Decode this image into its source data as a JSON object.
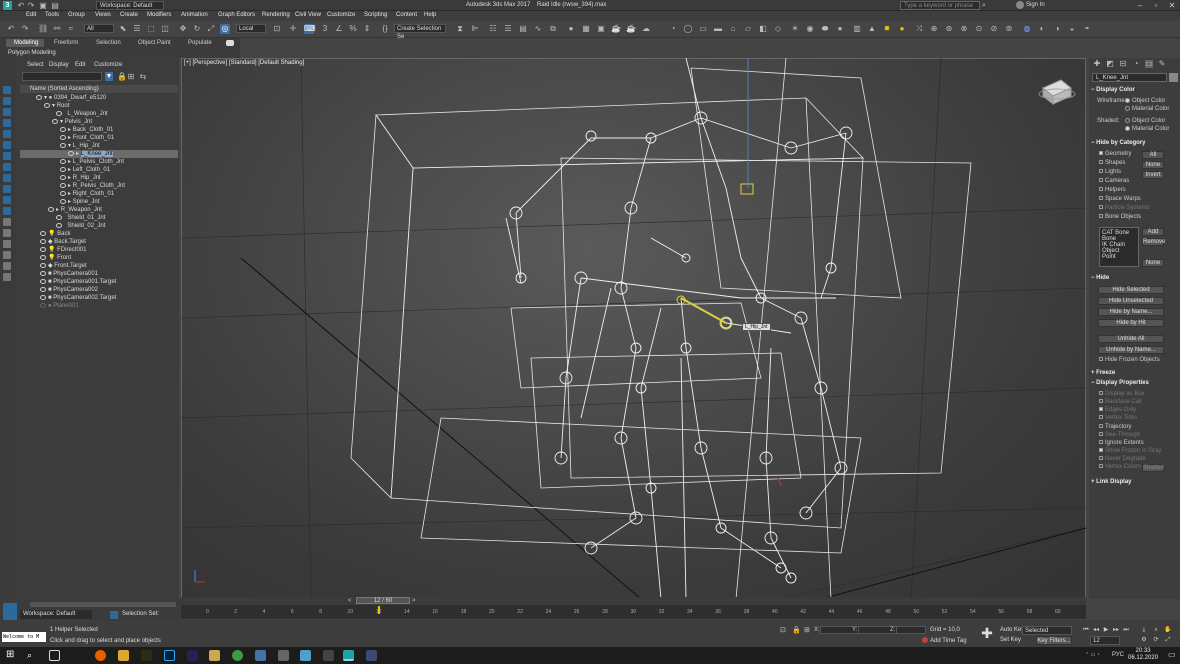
{
  "window": {
    "app_logo": "3",
    "workspace_label": "Workspace: Default",
    "title": "Autodesk 3ds Max 2017",
    "file_name": "Raid Idle (rwsw_394).max",
    "search_placeholder": "Type a keyword or phrase",
    "sign_in": "Sign In"
  },
  "menu": [
    "Edit",
    "Tools",
    "Group",
    "Views",
    "Create",
    "Modifiers",
    "Animation",
    "Graph Editors",
    "Rendering",
    "Civil View",
    "Customize",
    "Scripting",
    "Content",
    "Help"
  ],
  "toolbar": {
    "filter_dropdown": "All",
    "coord_dropdown": "Local",
    "create_selection_set": "Create Selection Se"
  },
  "ribbon": {
    "tabs": [
      "Modeling",
      "Freeform",
      "Selection",
      "Object Paint",
      "Populate"
    ],
    "sub_label": "Polygon Modeling"
  },
  "scene_explorer": {
    "menu": [
      "Select",
      "Display",
      "Edit",
      "Customize"
    ],
    "column_header": "Name (Sorted Ascending)",
    "rows": [
      {
        "label": "0394_Dwarf_e5120",
        "selected": false
      },
      {
        "label": "Root",
        "selected": false
      },
      {
        "label": "L_Weapon_Jnt",
        "selected": false
      },
      {
        "label": "Pelvis_Jnt",
        "selected": false
      },
      {
        "label": "Back_Cloth_01",
        "selected": false
      },
      {
        "label": "Front_Cloth_01",
        "selected": false
      },
      {
        "label": "L_Hip_Jnt",
        "selected": false
      },
      {
        "label": "L_Knee_Jnt",
        "selected": true
      },
      {
        "label": "L_Pelvis_Cloth_Jnt",
        "selected": false
      },
      {
        "label": "Left_Cloth_01",
        "selected": false
      },
      {
        "label": "R_Hip_Jnt",
        "selected": false
      },
      {
        "label": "R_Pelvis_Cloth_Jnt",
        "selected": false
      },
      {
        "label": "Right_Cloth_01",
        "selected": false
      },
      {
        "label": "Spine_Jnt",
        "selected": false
      },
      {
        "label": "R_Weapon_Jnt",
        "selected": false
      },
      {
        "label": "Shield_01_Jnt",
        "selected": false
      },
      {
        "label": "Shield_02_Jnt",
        "selected": false
      },
      {
        "label": "Back",
        "selected": false
      },
      {
        "label": "Back.Target",
        "selected": false
      },
      {
        "label": "FDirect001",
        "selected": false
      },
      {
        "label": "Front",
        "selected": false
      },
      {
        "label": "Front.Target",
        "selected": false
      },
      {
        "label": "PhysCamera001",
        "selected": false
      },
      {
        "label": "PhysCamera001.Target",
        "selected": false
      },
      {
        "label": "PhysCamera002",
        "selected": false
      },
      {
        "label": "PhysCamera002.Target",
        "selected": false
      },
      {
        "label": "Plane001",
        "selected": false
      }
    ]
  },
  "viewport": {
    "label": "[+] [Perspective] [Standard] [Default Shading]",
    "tooltip": "L_Hip_Jnt"
  },
  "command_panel": {
    "object_name": "L_Knee_Jnt",
    "display_color": {
      "title": "Display Color",
      "wireframe_label": "Wireframe:",
      "shaded_label": "Shaded:",
      "object_color": "Object Color",
      "material_color": "Material Color"
    },
    "hide_by_category": {
      "title": "Hide by Category",
      "items": [
        "Geometry",
        "Shapes",
        "Lights",
        "Cameras",
        "Helpers",
        "Space Warps",
        "Particle Systems",
        "Bone Objects"
      ],
      "buttons": [
        "All",
        "None",
        "Invert"
      ],
      "list": [
        "CAT Bone",
        "Bone",
        "IK Chain Object",
        "Point"
      ],
      "add": "Add",
      "remove": "Remove",
      "none": "None"
    },
    "hide": {
      "title": "Hide",
      "buttons": [
        "Hide Selected",
        "Hide Unselected",
        "Hide by Name...",
        "Hide by Hit",
        "Unhide All",
        "Unhide by Name...",
        "Hide Frozen Objects"
      ]
    },
    "freeze_title": "Freeze",
    "display_properties": {
      "title": "Display Properties",
      "items": [
        "Display as Box",
        "Backface Cull",
        "Edges Only",
        "Vertex Ticks",
        "Trajectory",
        "See-Through",
        "Ignore Extents",
        "Show Frozen in Gray",
        "Never Degrade",
        "Vertex Colors"
      ],
      "shaded_btn": "Shaded"
    },
    "link_display_title": "Link Display"
  },
  "timeline": {
    "slider": "12 / 60",
    "ticks": [
      "0",
      "2",
      "4",
      "6",
      "8",
      "10",
      "12",
      "14",
      "16",
      "18",
      "20",
      "22",
      "24",
      "26",
      "28",
      "30",
      "32",
      "34",
      "36",
      "38",
      "40",
      "42",
      "44",
      "46",
      "48",
      "50",
      "52",
      "54",
      "56",
      "58",
      "60"
    ]
  },
  "status": {
    "workspace": "Workspace: Default",
    "selection_set": "Selection Set:",
    "script_box": "Welcome to M",
    "line1": "1 Helper Selected",
    "line2": "Click and drag to select and place objects",
    "x_label": "X:",
    "y_label": "Y:",
    "z_label": "Z:",
    "grid": "Grid = 10,0",
    "add_time_tag": "Add Time Tag",
    "auto_key": "Auto Key",
    "set_key": "Set Key",
    "selected_dropdown": "Selected",
    "key_filters": "Key Filters...",
    "frame": "12"
  },
  "taskbar": {
    "lang": "РУС",
    "time": "20:33",
    "date": "06.12.2020"
  }
}
